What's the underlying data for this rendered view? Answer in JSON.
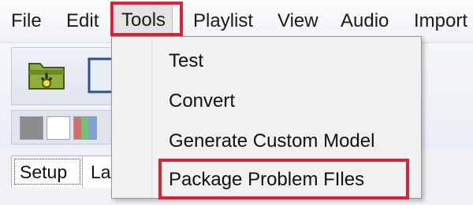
{
  "menubar": {
    "items": [
      {
        "label": "File"
      },
      {
        "label": "Edit"
      },
      {
        "label": "Tools"
      },
      {
        "label": "Playlist"
      },
      {
        "label": "View"
      },
      {
        "label": "Audio"
      },
      {
        "label": "Import"
      }
    ],
    "open_menu": "Tools"
  },
  "tools_menu": {
    "items": [
      {
        "label": "Test"
      },
      {
        "label": "Convert"
      },
      {
        "label": "Generate Custom Model"
      },
      {
        "label": "Package Problem FIles"
      }
    ],
    "highlighted_item": "Package Problem FIles"
  },
  "toolbar": {
    "icons": [
      "folder-arrow-icon",
      "document-icon"
    ],
    "swatches": [
      "#8c8c8c",
      "#ffffff",
      "#7fa0d8"
    ]
  },
  "tabs": [
    {
      "label": "Setup",
      "selected": true
    },
    {
      "label": "La",
      "selected": false
    }
  ],
  "colors": {
    "highlight_border": "#d6253a",
    "menu_background": "#f1f1f1"
  }
}
